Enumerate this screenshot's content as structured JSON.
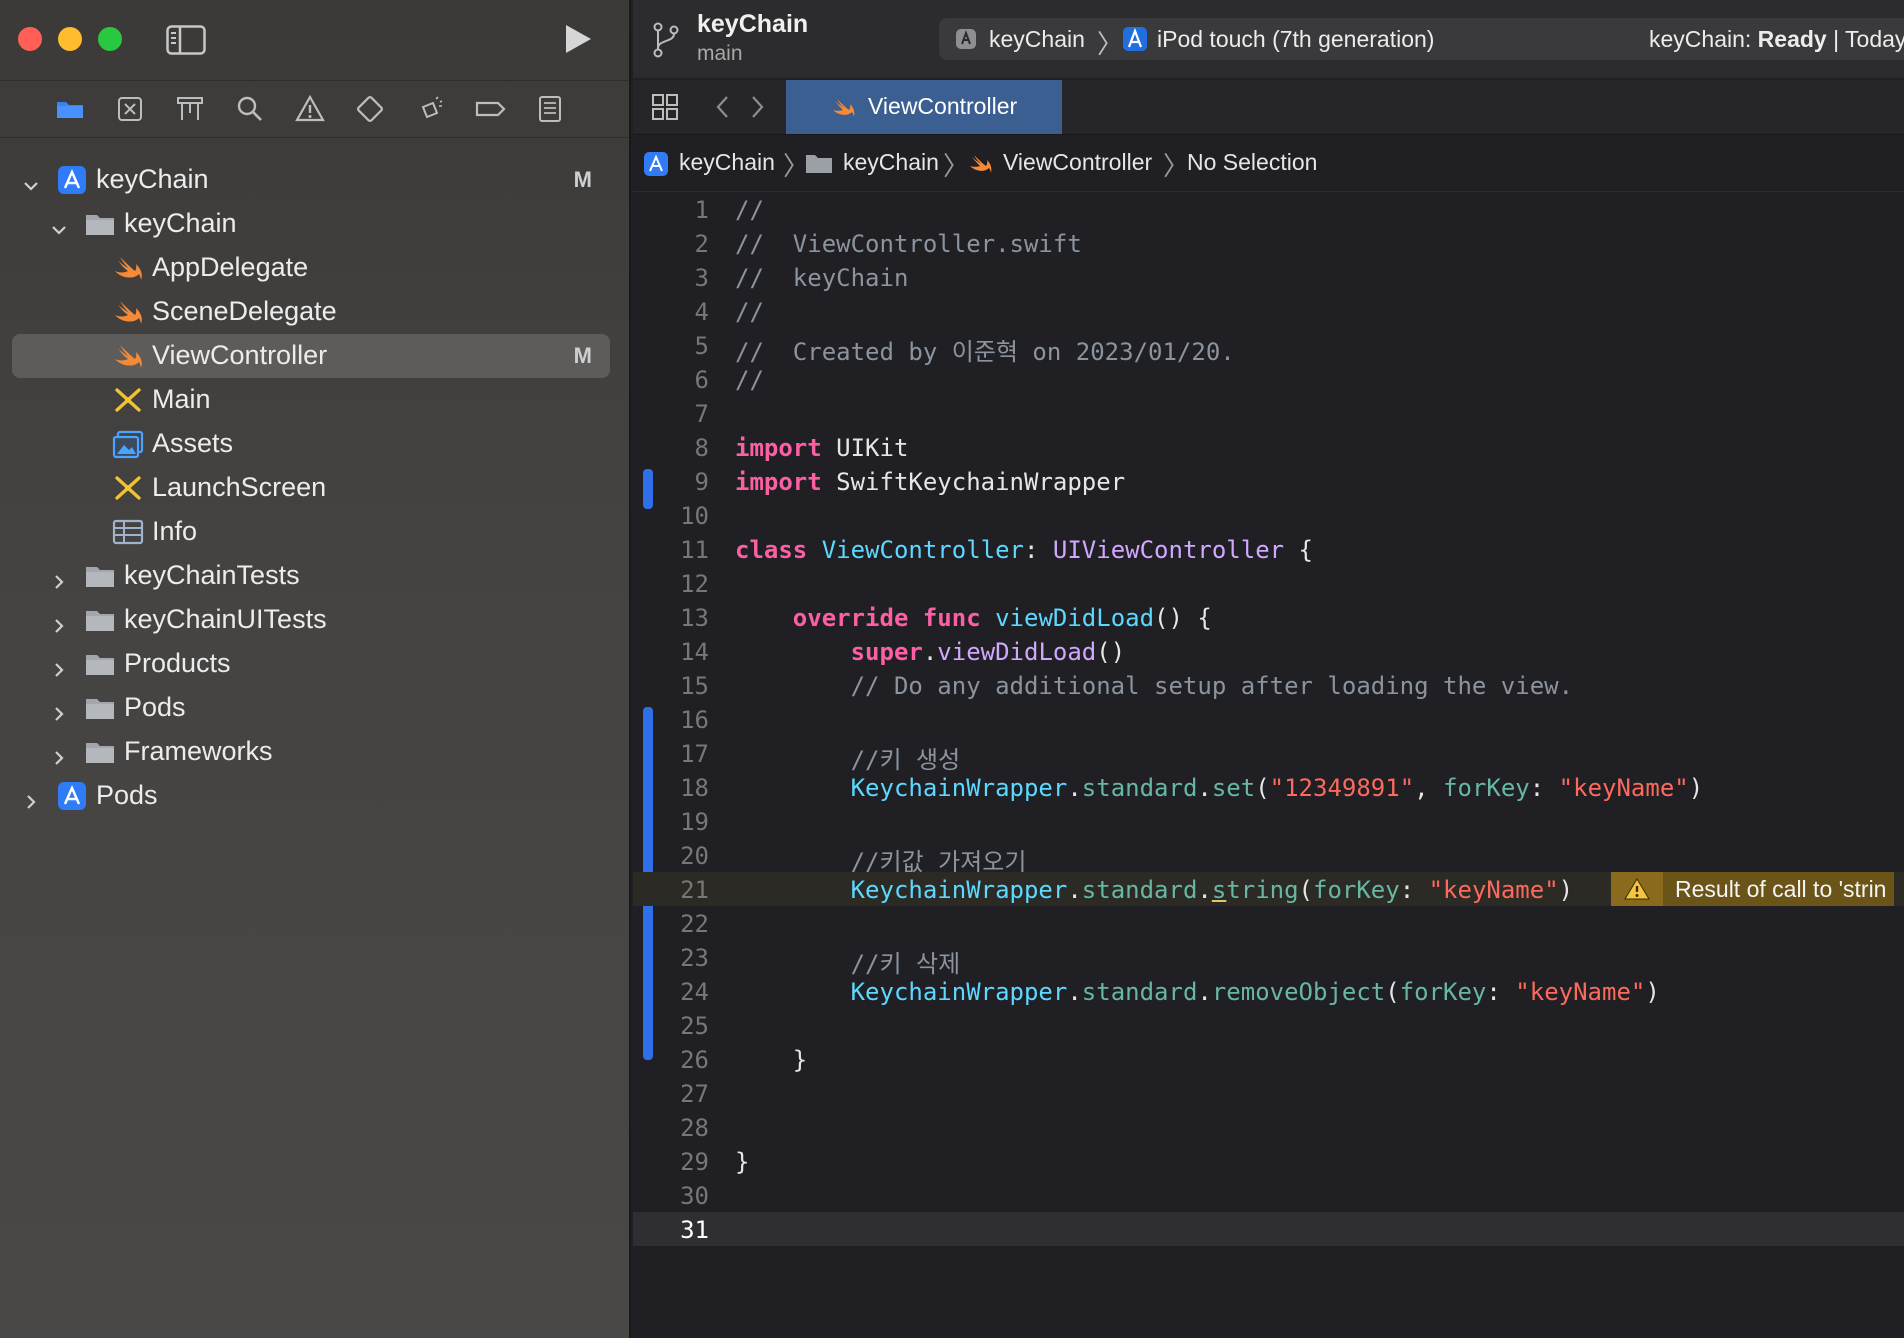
{
  "sidebar": {
    "nav_icons": [
      "folder-icon",
      "source-control-icon",
      "hierarchy-icon",
      "search-icon",
      "warning-icon",
      "test-icon",
      "debug-icon",
      "breakpoint-icon",
      "report-icon"
    ],
    "tree": [
      {
        "label": "keyChain",
        "badge": "M",
        "icon": "xcode-project-icon",
        "expanded": true
      },
      {
        "label": "keyChain",
        "icon": "folder-icon",
        "expanded": true
      },
      {
        "label": "AppDelegate",
        "icon": "swift-file-icon"
      },
      {
        "label": "SceneDelegate",
        "icon": "swift-file-icon"
      },
      {
        "label": "ViewController",
        "badge": "M",
        "icon": "swift-file-icon",
        "selected": true
      },
      {
        "label": "Main",
        "icon": "storyboard-icon"
      },
      {
        "label": "Assets",
        "icon": "assets-icon"
      },
      {
        "label": "LaunchScreen",
        "icon": "storyboard-icon"
      },
      {
        "label": "Info",
        "icon": "plist-icon"
      },
      {
        "label": "keyChainTests",
        "icon": "folder-icon",
        "expanded": false
      },
      {
        "label": "keyChainUITests",
        "icon": "folder-icon",
        "expanded": false
      },
      {
        "label": "Products",
        "icon": "folder-icon",
        "expanded": false
      },
      {
        "label": "Pods",
        "icon": "folder-icon",
        "expanded": false
      },
      {
        "label": "Frameworks",
        "icon": "folder-icon",
        "expanded": false
      },
      {
        "label": "Pods",
        "icon": "xcode-project-icon",
        "expanded": false
      }
    ]
  },
  "toolbar": {
    "project_title": "keyChain",
    "branch": "main",
    "scheme": "keyChain",
    "destination": "iPod touch (7th generation)",
    "status_prefix": "keyChain: ",
    "status_state": "Ready",
    "status_suffix": " | Today"
  },
  "tabs": {
    "active_label": "ViewController"
  },
  "jumpbar": {
    "items": [
      "keyChain",
      "keyChain",
      "ViewController",
      "No Selection"
    ]
  },
  "editor": {
    "current_line": 31,
    "warning": {
      "line": 21,
      "text": "Result of call to 'strin"
    },
    "line_numbers": [
      "1",
      "2",
      "3",
      "4",
      "5",
      "6",
      "7",
      "8",
      "9",
      "10",
      "11",
      "12",
      "13",
      "14",
      "15",
      "16",
      "17",
      "18",
      "19",
      "20",
      "21",
      "22",
      "23",
      "24",
      "25",
      "26",
      "27",
      "28",
      "29",
      "30",
      "31"
    ],
    "lines": [
      [
        [
          "cm",
          "//"
        ]
      ],
      [
        [
          "cm",
          "//  ViewController.swift"
        ]
      ],
      [
        [
          "cm",
          "//  keyChain"
        ]
      ],
      [
        [
          "cm",
          "//"
        ]
      ],
      [
        [
          "cm",
          "//  Created by 이준혁 on 2023/01/20."
        ]
      ],
      [
        [
          "cm",
          "//"
        ]
      ],
      [],
      [
        [
          "kw",
          "import"
        ],
        [
          "",
          " UIKit"
        ]
      ],
      [
        [
          "kw",
          "import"
        ],
        [
          "",
          " SwiftKeychainWrapper"
        ]
      ],
      [],
      [
        [
          "kw",
          "class"
        ],
        [
          "",
          " "
        ],
        [
          "ty",
          "ViewController"
        ],
        [
          "",
          ": "
        ],
        [
          "sy",
          "UIViewController"
        ],
        [
          "",
          " {"
        ]
      ],
      [],
      [
        [
          "",
          "    "
        ],
        [
          "kw",
          "override"
        ],
        [
          "",
          " "
        ],
        [
          "kw",
          "func"
        ],
        [
          "",
          " "
        ],
        [
          "ty",
          "viewDidLoad"
        ],
        [
          "",
          "() {"
        ]
      ],
      [
        [
          "",
          "        "
        ],
        [
          "kw",
          "super"
        ],
        [
          "",
          "."
        ],
        [
          "sy",
          "viewDidLoad"
        ],
        [
          "",
          "()"
        ]
      ],
      [
        [
          "",
          "        "
        ],
        [
          "cm",
          "// Do any additional setup after loading the view."
        ]
      ],
      [],
      [
        [
          "",
          "        "
        ],
        [
          "cm",
          "//키 생성"
        ]
      ],
      [
        [
          "",
          "        "
        ],
        [
          "ty",
          "KeychainWrapper"
        ],
        [
          "",
          "."
        ],
        [
          "fn",
          "standard"
        ],
        [
          "",
          "."
        ],
        [
          "fn",
          "set"
        ],
        [
          "",
          "("
        ],
        [
          "st",
          "\"12349891\""
        ],
        [
          "",
          ", "
        ],
        [
          "fn",
          "forKey"
        ],
        [
          "",
          ": "
        ],
        [
          "st",
          "\"keyName\""
        ],
        [
          "",
          ")"
        ]
      ],
      [],
      [
        [
          "",
          "        "
        ],
        [
          "cm",
          "//키값 가져오기"
        ]
      ],
      [
        [
          "",
          "        "
        ],
        [
          "ty",
          "KeychainWrapper"
        ],
        [
          "",
          "."
        ],
        [
          "fn",
          "standard"
        ],
        [
          "",
          "."
        ],
        [
          "fnwu",
          "s"
        ],
        [
          "fn",
          "tring"
        ],
        [
          "",
          "("
        ],
        [
          "fn",
          "forKey"
        ],
        [
          "",
          ": "
        ],
        [
          "st",
          "\"keyName\""
        ],
        [
          "",
          ")"
        ]
      ],
      [],
      [
        [
          "",
          "        "
        ],
        [
          "cm",
          "//키 삭제"
        ]
      ],
      [
        [
          "",
          "        "
        ],
        [
          "ty",
          "KeychainWrapper"
        ],
        [
          "",
          "."
        ],
        [
          "fn",
          "standard"
        ],
        [
          "",
          "."
        ],
        [
          "fn",
          "removeObject"
        ],
        [
          "",
          "("
        ],
        [
          "fn",
          "forKey"
        ],
        [
          "",
          ": "
        ],
        [
          "st",
          "\"keyName\""
        ],
        [
          "",
          ")"
        ]
      ],
      [],
      [
        [
          "",
          "    }"
        ]
      ],
      [],
      [],
      [
        [
          "",
          "}"
        ]
      ],
      [],
      []
    ]
  }
}
